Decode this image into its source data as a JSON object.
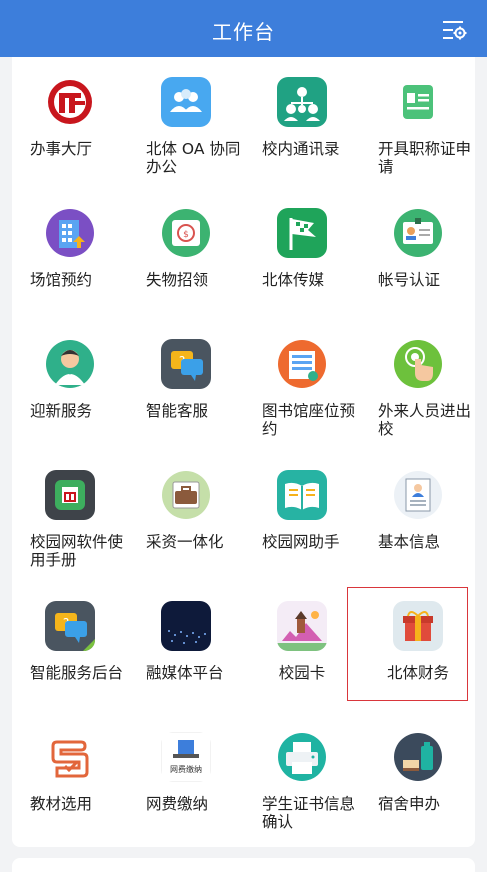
{
  "header": {
    "title": "工作台"
  },
  "apps": [
    {
      "label": "办事大厅",
      "icon": "red-logo-icon"
    },
    {
      "label": "北体 OA 协同办公",
      "icon": "people-group-icon"
    },
    {
      "label": "校内通讯录",
      "icon": "contacts-network-icon"
    },
    {
      "label": "开具职称证申请",
      "icon": "id-card-icon"
    },
    {
      "label": "场馆预约",
      "icon": "building-icon"
    },
    {
      "label": "失物招领",
      "icon": "lost-found-icon"
    },
    {
      "label": "北体传媒",
      "icon": "flag-icon"
    },
    {
      "label": "帐号认证",
      "icon": "badge-icon"
    },
    {
      "label": "迎新服务",
      "icon": "welcome-person-icon"
    },
    {
      "label": "智能客服",
      "icon": "chat-bubbles-icon"
    },
    {
      "label": "图书馆座位预约",
      "icon": "library-icon"
    },
    {
      "label": "外来人员进出校",
      "icon": "tap-hand-icon"
    },
    {
      "label": "校园网软件使用手册",
      "icon": "manual-icon"
    },
    {
      "label": "采资一体化",
      "icon": "briefcase-icon"
    },
    {
      "label": "校园网助手",
      "icon": "open-book-icon"
    },
    {
      "label": "基本信息",
      "icon": "profile-document-icon"
    },
    {
      "label": "智能服务后台",
      "icon": "chat-bubbles-icon"
    },
    {
      "label": "融媒体平台",
      "icon": "media-platform-icon"
    },
    {
      "label": "校园卡",
      "icon": "campus-card-icon"
    },
    {
      "label": "北体财务",
      "icon": "gift-box-icon"
    },
    {
      "label": "教材选用",
      "icon": "textbook-icon"
    },
    {
      "label": "网费缴纳",
      "icon": "network-fee-icon",
      "icon_text": "网费缴纳"
    },
    {
      "label": "学生证书信息确认",
      "icon": "printer-icon"
    },
    {
      "label": "宿舍申办",
      "icon": "dorm-icon"
    }
  ]
}
